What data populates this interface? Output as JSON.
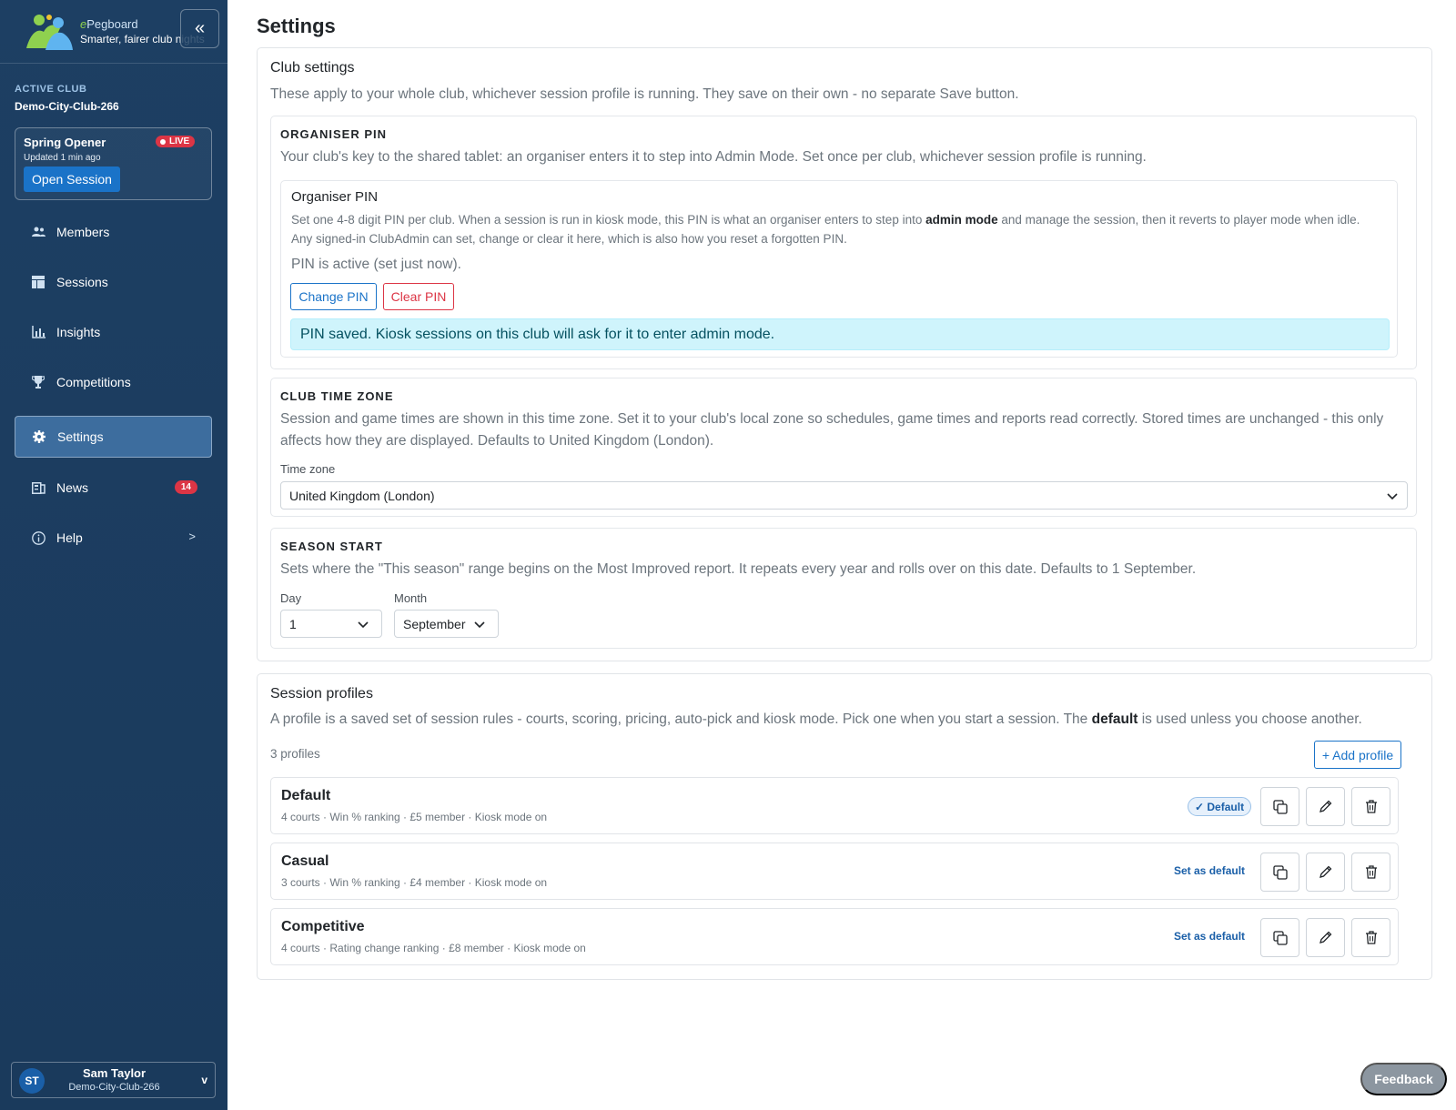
{
  "app": {
    "name_prefix": "e",
    "name_rest": "Pegboard",
    "tagline": "Smarter, fairer club nights"
  },
  "sidebar": {
    "active_club_label": "ACTIVE CLUB",
    "active_club_name": "Demo-City-Club-266",
    "live_session": {
      "title": "Spring Opener",
      "badge": "LIVE",
      "updated": "Updated 1 min ago",
      "open_label": "Open Session"
    },
    "items": [
      {
        "label": "Members",
        "icon": "members-icon"
      },
      {
        "label": "Sessions",
        "icon": "sessions-icon"
      },
      {
        "label": "Insights",
        "icon": "insights-icon"
      },
      {
        "label": "Competitions",
        "icon": "trophy-icon"
      },
      {
        "label": "Settings",
        "icon": "gear-icon",
        "active": true
      },
      {
        "label": "News",
        "icon": "news-icon",
        "badge": "14"
      },
      {
        "label": "Help",
        "icon": "info-icon",
        "chevron": ">"
      }
    ],
    "user": {
      "initials": "ST",
      "name": "Sam Taylor",
      "club": "Demo-City-Club-266",
      "chevron": "v"
    }
  },
  "page": {
    "title": "Settings"
  },
  "club_settings": {
    "title": "Club settings",
    "description": "These apply to your whole club, whichever session profile is running. They save on their own - no separate Save button.",
    "pin": {
      "heading": "ORGANISER PIN",
      "description": "Your club's key to the shared tablet: an organiser enters it to step into Admin Mode. Set once per club, whichever session profile is running.",
      "box_title": "Organiser PIN",
      "help_part1": "Set one 4-8 digit PIN per club. When a session is run in kiosk mode, this PIN is what an organiser enters to step into ",
      "help_bold": "admin mode",
      "help_part2": " and manage the session, then it reverts to player mode when idle. Any signed-in ClubAdmin can set, change or clear it here, which is also how you reset a forgotten PIN.",
      "status": "PIN is active (set just now).",
      "change_label": "Change PIN",
      "clear_label": "Clear PIN",
      "alert": "PIN saved. Kiosk sessions on this club will ask for it to enter admin mode."
    },
    "timezone": {
      "heading": "CLUB TIME ZONE",
      "description": "Session and game times are shown in this time zone. Set it to your club's local zone so schedules, game times and reports read correctly. Stored times are unchanged - this only affects how they are displayed. Defaults to United Kingdom (London).",
      "label": "Time zone",
      "value": "United Kingdom (London)"
    },
    "season": {
      "heading": "SEASON START",
      "description": "Sets where the \"This season\" range begins on the Most Improved report. It repeats every year and rolls over on this date. Defaults to 1 September.",
      "day_label": "Day",
      "day_value": "1",
      "month_label": "Month",
      "month_value": "September"
    }
  },
  "session_profiles": {
    "title": "Session profiles",
    "desc_part1": "A profile is a saved set of session rules - courts, scoring, pricing, auto-pick and kiosk mode. Pick one when you start a session. The ",
    "desc_bold": "default",
    "desc_part2": " is used unless you choose another.",
    "count": "3 profiles",
    "add_label": "+ Add profile",
    "default_pill": "✓ Default",
    "set_default_label": "Set as default",
    "profiles": [
      {
        "name": "Default",
        "meta": "4 courts · Win % ranking · £5 member · Kiosk mode on",
        "is_default": true
      },
      {
        "name": "Casual",
        "meta": "3 courts · Win % ranking · £4 member · Kiosk mode on",
        "is_default": false
      },
      {
        "name": "Competitive",
        "meta": "4 courts · Rating change ranking · £8 member · Kiosk mode on",
        "is_default": false
      }
    ]
  },
  "feedback_label": "Feedback",
  "colors": {
    "sidebar_bg": "#1d3f63",
    "accent": "#1a73c8",
    "danger": "#dc3545",
    "alert_bg": "#cff4fc"
  }
}
